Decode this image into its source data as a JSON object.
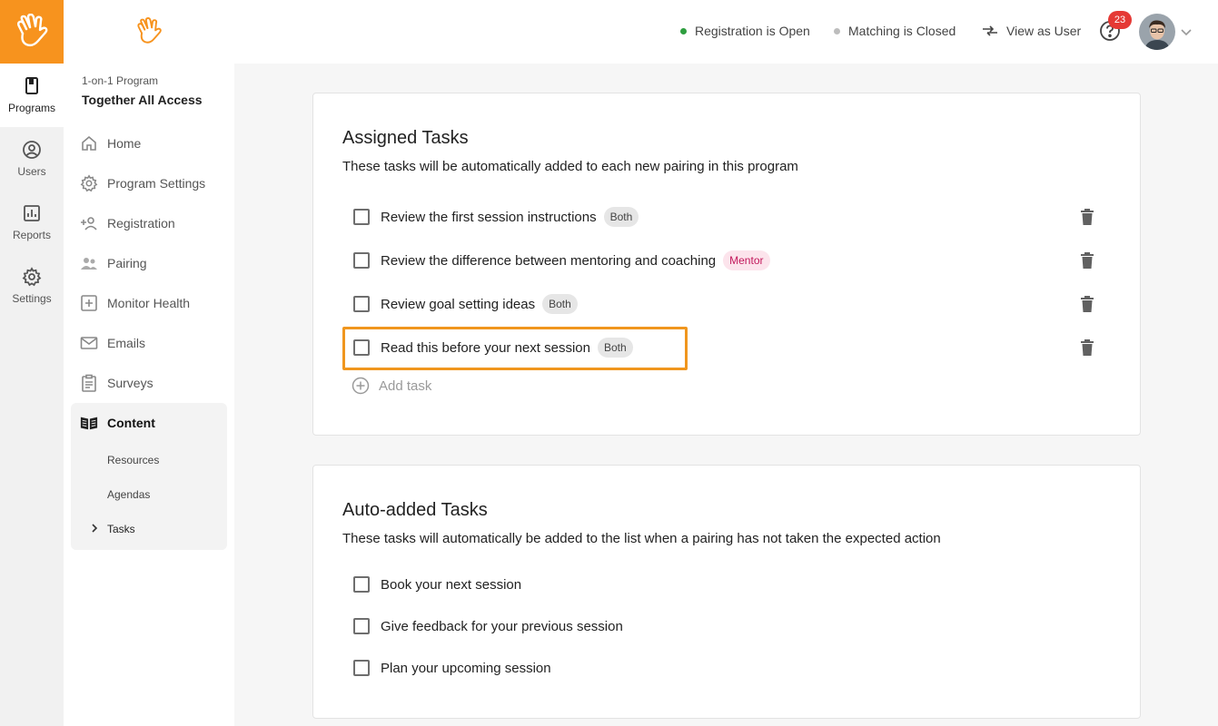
{
  "rail": {
    "items": [
      {
        "label": "Programs",
        "icon": "book-icon",
        "active": true
      },
      {
        "label": "Users",
        "icon": "user-circle-icon",
        "active": false
      },
      {
        "label": "Reports",
        "icon": "chart-icon",
        "active": false
      },
      {
        "label": "Settings",
        "icon": "gear-icon",
        "active": false
      }
    ]
  },
  "colors": {
    "brand": "#f7931e",
    "status_open": "#2e9e3f",
    "status_closed": "#bdbdbd",
    "highlight": "#f0961e",
    "badge": "#e53935"
  },
  "sidebar": {
    "program_kind": "1-on-1 Program",
    "program_name": "Together All Access",
    "items": [
      {
        "label": "Home",
        "icon": "home-icon"
      },
      {
        "label": "Program Settings",
        "icon": "gear-icon"
      },
      {
        "label": "Registration",
        "icon": "add-user-icon"
      },
      {
        "label": "Pairing",
        "icon": "people-icon"
      },
      {
        "label": "Monitor Health",
        "icon": "plus-square-icon"
      },
      {
        "label": "Emails",
        "icon": "mail-icon"
      },
      {
        "label": "Surveys",
        "icon": "clipboard-icon"
      }
    ],
    "content": {
      "label": "Content",
      "icon": "open-book-icon",
      "sub_items": [
        "Resources",
        "Agendas",
        "Tasks"
      ]
    }
  },
  "topbar": {
    "registration_status": "Registration is Open",
    "matching_status": "Matching is Closed",
    "view_as_user": "View as User",
    "notification_count": "23"
  },
  "assigned": {
    "title": "Assigned Tasks",
    "description": "These tasks will be automatically added to each new pairing in this program",
    "tasks": [
      {
        "label": "Review the first session instructions",
        "tag": "Both"
      },
      {
        "label": "Review the difference between mentoring and coaching",
        "tag": "Mentor"
      },
      {
        "label": "Review goal setting ideas",
        "tag": "Both"
      },
      {
        "label": "Read this before your next session",
        "tag": "Both"
      }
    ],
    "add_label": "Add task"
  },
  "auto": {
    "title": "Auto-added Tasks",
    "description": "These tasks will automatically be added to the list when a pairing has not taken the expected action",
    "tasks": [
      {
        "label": "Book your next session"
      },
      {
        "label": "Give feedback for your previous session"
      },
      {
        "label": "Plan your upcoming session"
      }
    ]
  }
}
